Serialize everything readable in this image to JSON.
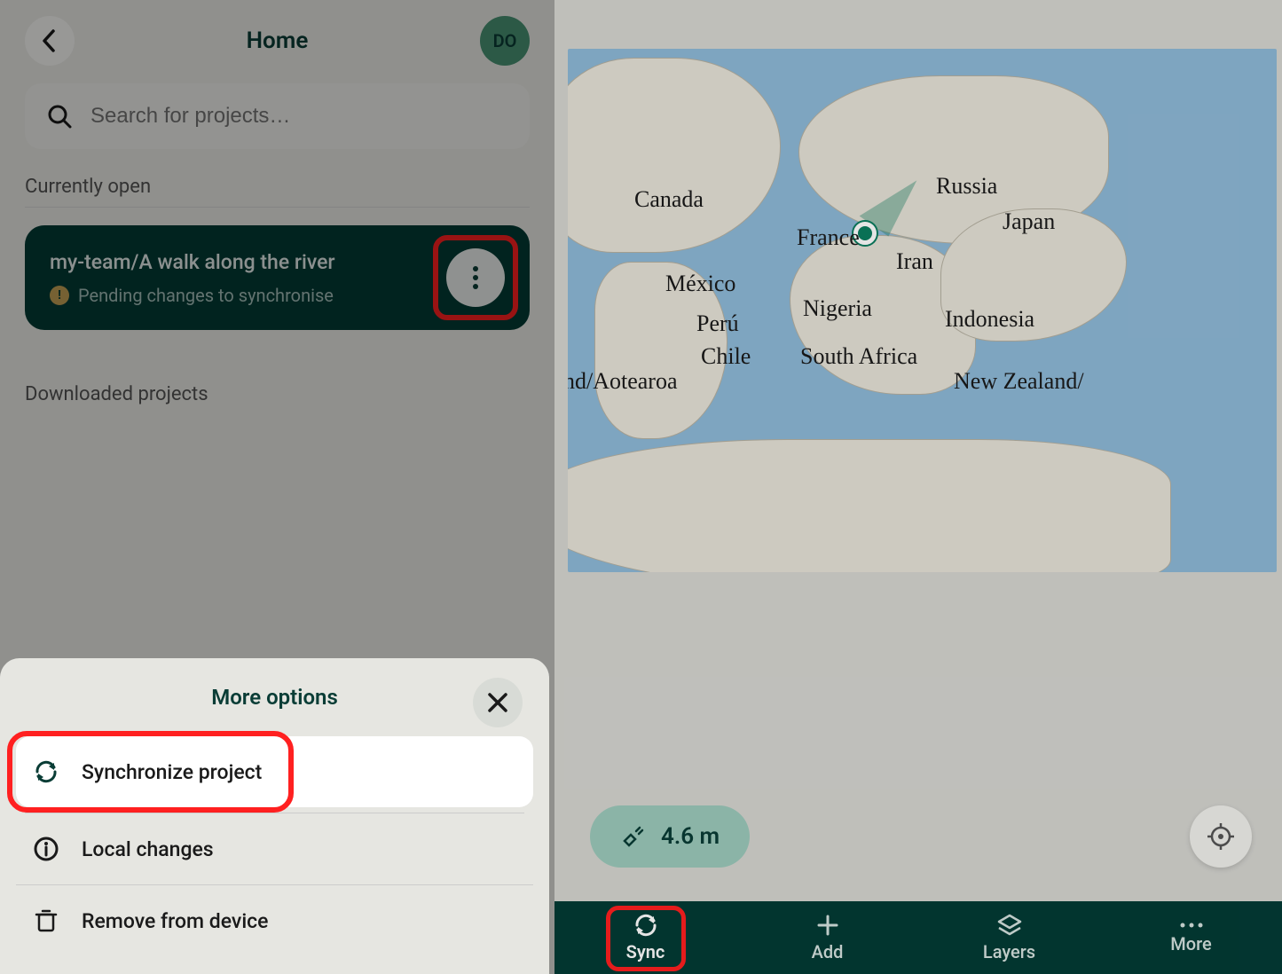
{
  "header": {
    "title": "Home",
    "avatar_initials": "DO"
  },
  "search": {
    "placeholder": "Search for projects…"
  },
  "sections": {
    "currently_open": "Currently open",
    "downloaded": "Downloaded projects"
  },
  "project": {
    "title": "my-team/A walk along the river",
    "status": "Pending changes to synchronise"
  },
  "sheet": {
    "title": "More options",
    "options": {
      "sync": "Synchronize project",
      "local": "Local changes",
      "remove": "Remove from device"
    }
  },
  "map": {
    "labels": {
      "canada": "Canada",
      "russia": "Russia",
      "france": "France",
      "iran": "Iran",
      "japan": "Japan",
      "mexico": "México",
      "nigeria": "Nigeria",
      "indonesia": "Indonesia",
      "peru": "Perú",
      "chile": "Chile",
      "south_africa": "South Africa",
      "nz_left": "nd/Aotearoa",
      "nz_right": "New Zealand/"
    },
    "accuracy_label": "4.6 m"
  },
  "navbar": {
    "sync": "Sync",
    "add": "Add",
    "layers": "Layers",
    "more": "More"
  },
  "colors": {
    "brand_dark": "#033b35",
    "accent_green": "#0b7d5f",
    "highlight_red": "#ff2020"
  }
}
